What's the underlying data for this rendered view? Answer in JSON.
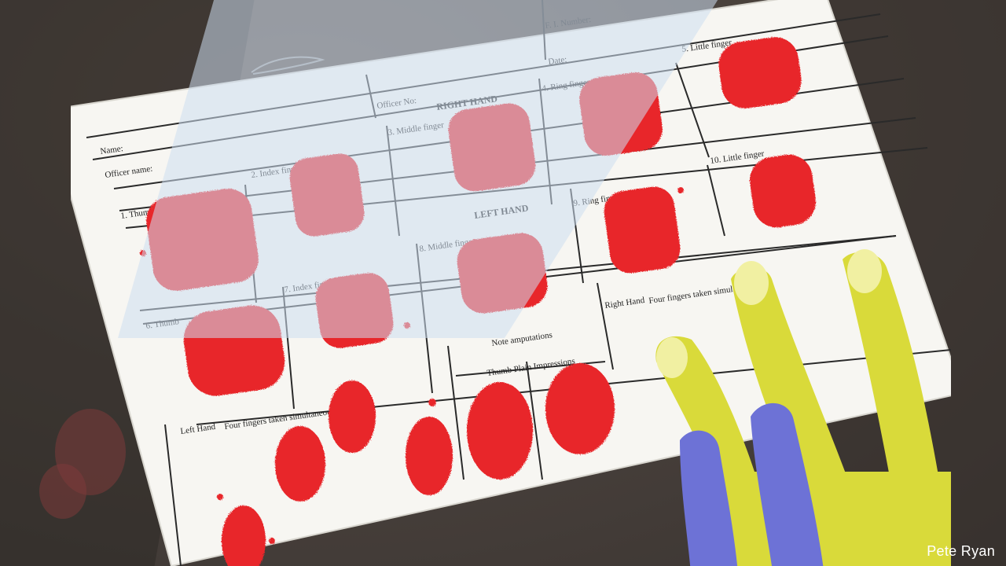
{
  "form": {
    "fi_number_label": "F. I. Number:",
    "date_label": "Date:",
    "officer_no_label": "Officer No:",
    "name_label": "Name:",
    "officer_name_label": "Officer name:",
    "right_hand_heading": "RIGHT HAND",
    "left_hand_heading": "LEFT HAND",
    "fingers": {
      "thumb_right": "1. Thumb",
      "index_right": "2. Index finger",
      "middle_right": "3. Middle finger",
      "ring_right": "4. Ring finger",
      "little_right": "5. Little finger",
      "thumb_left": "6. Thumb",
      "index_left": "7. Index finger",
      "middle_left": "8. Middle finger",
      "ring_left": "9. Ring finger",
      "little_left": "10. Little finger"
    },
    "note_amputations": "Note amputations",
    "thumb_plain_impressions": "Thumb Plain Impressions",
    "left_hand_label": "Left Hand",
    "right_hand_label": "Right Hand",
    "four_fingers_label": "Four fingers taken simultaneously"
  },
  "credit": "Pete Ryan",
  "colors": {
    "ink": "#e8262c",
    "paper": "#f7f6f2",
    "hand_yellow": "#d9da3a",
    "hand_blue": "#6d72d6",
    "background": "#3f3a36"
  }
}
